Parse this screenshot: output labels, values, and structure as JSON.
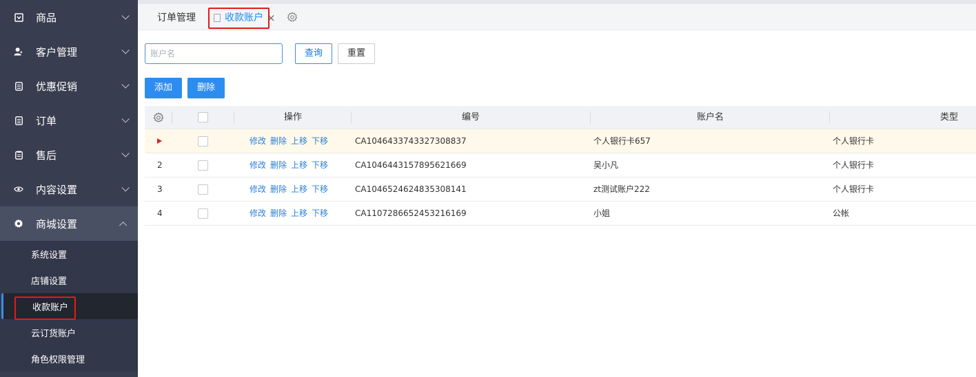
{
  "sidebar": {
    "items": [
      {
        "label": "商品",
        "icon": "tag-icon"
      },
      {
        "label": "客户管理",
        "icon": "user-icon"
      },
      {
        "label": "优惠促销",
        "icon": "document-icon"
      },
      {
        "label": "订单",
        "icon": "document-icon"
      },
      {
        "label": "售后",
        "icon": "clipboard-icon"
      },
      {
        "label": "内容设置",
        "icon": "eye-icon"
      },
      {
        "label": "商城设置",
        "icon": "gear-icon"
      }
    ],
    "sub_items": [
      "系统设置",
      "店铺设置",
      "收款账户",
      "云订货账户",
      "角色权限管理"
    ]
  },
  "tabs": {
    "orders": "订单管理",
    "active": "收款账户",
    "close": "×"
  },
  "toolbar": {
    "search_placeholder": "账户名",
    "query": "查询",
    "reset": "重置",
    "add": "添加",
    "delete": "删除"
  },
  "table": {
    "headers": {
      "ops": "操作",
      "code": "编号",
      "name": "账户名",
      "type": "类型"
    },
    "ops": [
      "修改",
      "删除",
      "上移",
      "下移"
    ],
    "rows": [
      {
        "index": "",
        "code": "CA1046433743327308837",
        "name": "个人银行卡657",
        "type": "个人银行卡",
        "current": true
      },
      {
        "index": "2",
        "code": "CA1046443157895621669",
        "name": "吴小凡",
        "type": "个人银行卡",
        "current": false
      },
      {
        "index": "3",
        "code": "CA1046524624835308141",
        "name": "zt测试账户222",
        "type": "个人银行卡",
        "current": false
      },
      {
        "index": "4",
        "code": "CA1107286652453216169",
        "name": "小姐",
        "type": "公帐",
        "current": false
      }
    ]
  },
  "colors": {
    "sidebar_bg": "#383e4f",
    "primary": "#2d8cf0",
    "highlight_red": "#e31b1b"
  }
}
